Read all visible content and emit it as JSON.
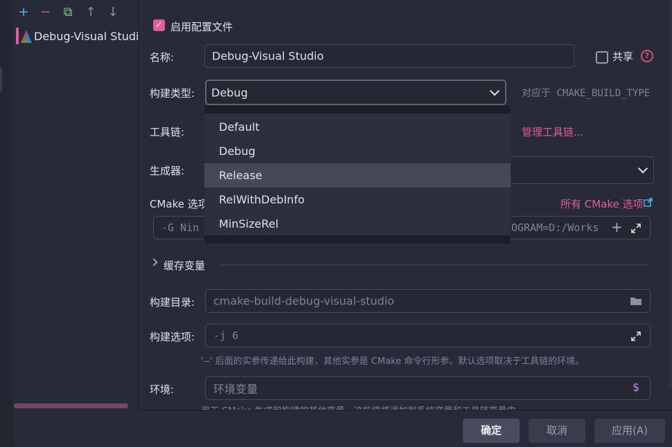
{
  "sidebar": {
    "toolbar": {
      "add": "+",
      "remove": "−",
      "copy": "⧉",
      "up": "↑",
      "down": "↓"
    },
    "items": [
      {
        "label": "Debug-Visual Studio"
      }
    ]
  },
  "enable_profile": {
    "label": "启用配置文件",
    "checked": true
  },
  "name": {
    "label": "名称:",
    "value": "Debug-Visual Studio"
  },
  "share": {
    "label": "共享",
    "help": "?"
  },
  "build_type": {
    "label": "构建类型:",
    "value": "Debug",
    "hint": "对应于 CMAKE_BUILD_TYPE",
    "options": [
      "Default",
      "Debug",
      "Release",
      "RelWithDebInfo",
      "MinSizeRel"
    ],
    "highlighted": "Release"
  },
  "toolchain": {
    "label": "工具链:",
    "manage_link": "管理工具链..."
  },
  "generator": {
    "label": "生成器:"
  },
  "cmake_options": {
    "label": "CMake 选项",
    "all_options_link": "所有 CMake 选项",
    "value_left": "-G Nin",
    "value_right": "OGRAM=D:/Works"
  },
  "cache": {
    "label": "缓存变量"
  },
  "build_dir": {
    "label": "构建目录:",
    "value": "cmake-build-debug-visual-studio"
  },
  "build_options": {
    "label": "构建选项:",
    "value": "-j 6",
    "hint": "'--' 后面的实参传递给此构建，其他实参是 CMake 命令行形参。默认选项取决于工具链的环境。"
  },
  "environment": {
    "label": "环境:",
    "placeholder": "环境变量",
    "hint": "用于 CMake 生成和构建的其他变量。这些值将添加到系统变量和工具链变量中。"
  },
  "buttons": {
    "ok": "确定",
    "cancel": "取消",
    "apply": "应用(A)"
  },
  "colors": {
    "accent": "#e35c9a",
    "background": "#272a38",
    "field": "#252833"
  }
}
